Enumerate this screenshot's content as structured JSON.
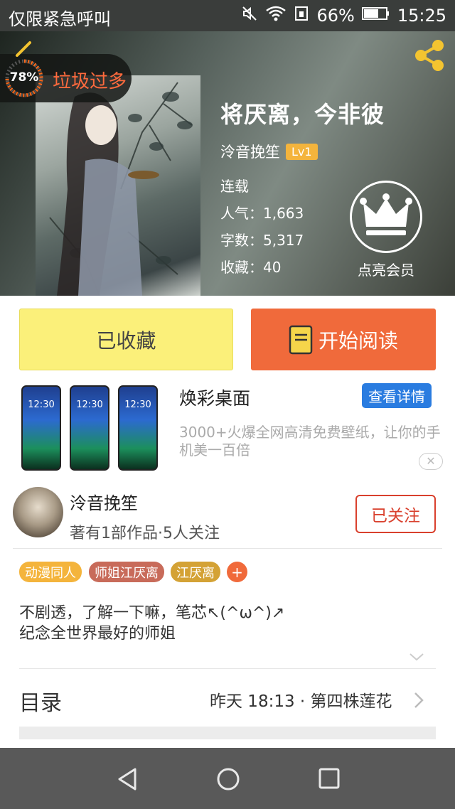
{
  "status_bar": {
    "left_text": "仅限紧急呼叫",
    "battery": "66%",
    "time": "15:25",
    "icons": [
      "mute-icon",
      "wifi-icon",
      "sim-icon",
      "battery-icon"
    ]
  },
  "header": {
    "garbage_percent": "78%",
    "garbage_level": 0.78,
    "garbage_label": "垃圾过多",
    "book_title": "将厌离，今非彼",
    "author": "泠音挽笙",
    "level": "Lv1",
    "status": "连载",
    "popularity": "人气：1,663",
    "word_count": "字数：5,317",
    "favorites": "收藏：40",
    "vip_label": "点亮会员"
  },
  "actions": {
    "favorited_label": "已收藏",
    "read_label": "开始阅读"
  },
  "ad": {
    "title": "焕彩桌面",
    "button": "查看详情",
    "description": "3000+火爆全网高清免费壁纸，让你的手机美一百倍",
    "phone_time": "12:30"
  },
  "author_section": {
    "name": "泠音挽笙",
    "info": "著有1部作品·5人关注",
    "follow_label": "已关注"
  },
  "tags": [
    "动漫同人",
    "师姐江厌离",
    "江厌离"
  ],
  "tag_colors": [
    "#f4b43c",
    "#c86b5a",
    "#d4a235"
  ],
  "description": [
    "不剧透，了解一下嘛，笔芯↖(^ω^)↗",
    "纪念全世界最好的师姐"
  ],
  "toc": {
    "label": "目录",
    "latest": "昨天 18:13 · 第四株莲花"
  }
}
